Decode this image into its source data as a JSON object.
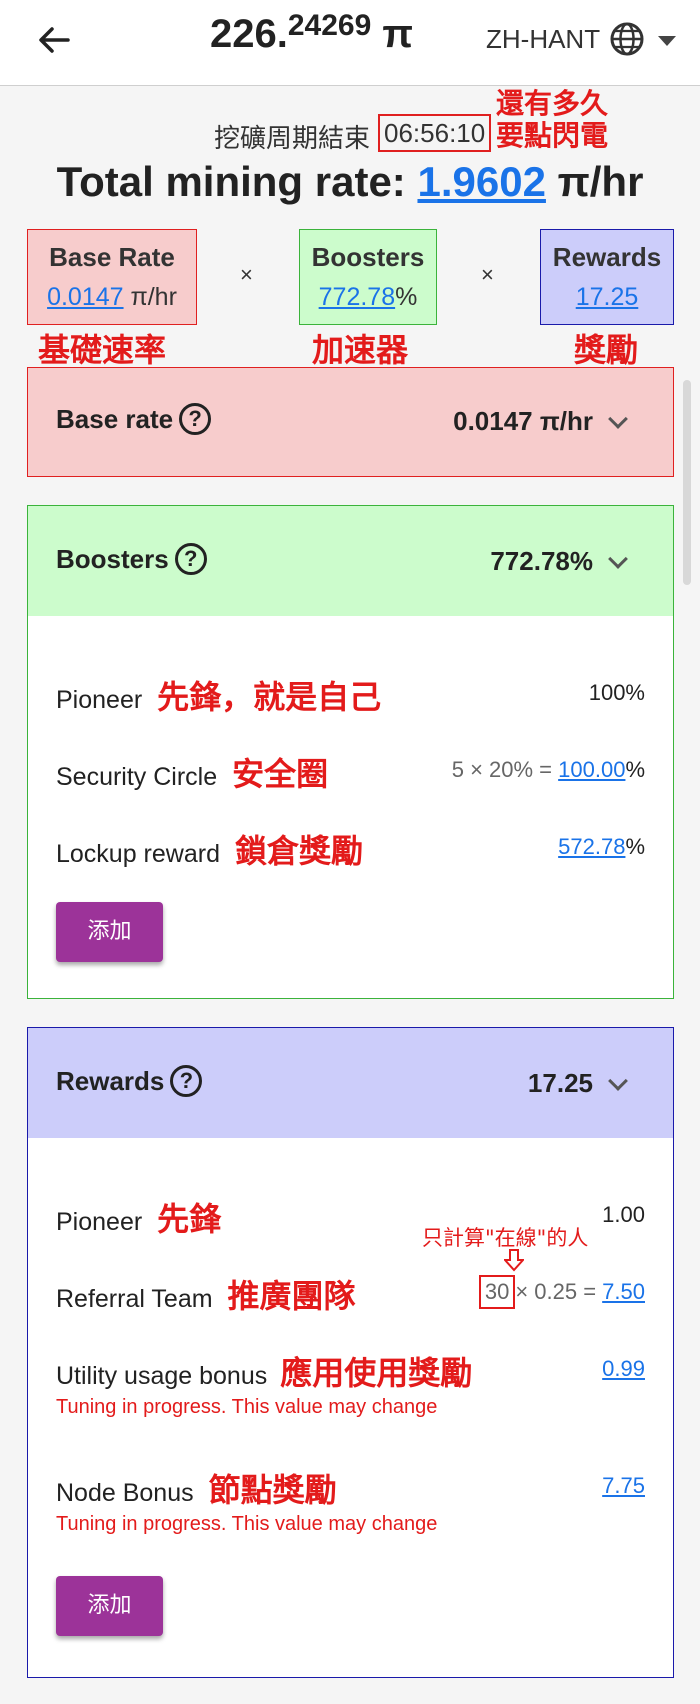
{
  "header": {
    "balance_int": "226.",
    "balance_frac": "24269",
    "balance_unit": "π",
    "language": "ZH-HANT"
  },
  "cycle": {
    "label": "挖礦周期結束",
    "time": "06:56:10",
    "annotation_line1": "還有多久",
    "annotation_line2": "要點閃電"
  },
  "total": {
    "label": "Total mining rate: ",
    "rate": "1.9602",
    "unit": " π/hr"
  },
  "summary": {
    "base": {
      "title": "Base Rate",
      "value": "0.0147",
      "unit": " π/hr",
      "annotation": "基礎速率"
    },
    "boosters": {
      "title": "Boosters",
      "value": "772.78",
      "unit": "%",
      "annotation": "加速器"
    },
    "rewards": {
      "title": "Rewards",
      "value": "17.25",
      "unit": "",
      "annotation": "獎勵"
    },
    "times": "×"
  },
  "base_card": {
    "title": "Base rate",
    "help": "?",
    "value": "0.0147 π/hr"
  },
  "boosters_card": {
    "title": "Boosters",
    "help": "?",
    "value": "772.78%",
    "rows": [
      {
        "label": "Pioneer",
        "annotation": "先鋒，就是自己",
        "value": "100%"
      },
      {
        "label": "Security Circle",
        "annotation": "安全圈",
        "formula": "5 × 20% = ",
        "value": "100.00",
        "unit": "%"
      },
      {
        "label": "Lockup reward",
        "annotation": "鎖倉獎勵",
        "value": "572.78",
        "unit": "%"
      }
    ],
    "add_button": "添加"
  },
  "rewards_card": {
    "title": "Rewards",
    "help": "?",
    "value": "17.25",
    "rows": [
      {
        "label": "Pioneer",
        "annotation": "先鋒",
        "value": "1.00"
      },
      {
        "label": "Referral Team",
        "annotation": "推廣團隊",
        "count": "30",
        "formula": "× 0.25 = ",
        "value": "7.50",
        "note": "只計算\"在線\"的人"
      },
      {
        "label": "Utility usage bonus",
        "annotation": "應用使用獎勵",
        "value": "0.99",
        "warning": "Tuning in progress. This value may change"
      },
      {
        "label": "Node Bonus",
        "annotation": "節點獎勵",
        "value": "7.75",
        "warning": "Tuning in progress. This value may change"
      }
    ],
    "add_button": "添加"
  },
  "colors": {
    "base_bg": "#f7cccc",
    "base_border": "#e02020",
    "boosters_bg": "#ccfccc",
    "boosters_border": "#3bb33b",
    "rewards_bg": "#cccdfa",
    "rewards_border": "#1a1aaa",
    "link": "#1a73e8",
    "annotation": "#e31b1b",
    "button": "#9c3399"
  }
}
